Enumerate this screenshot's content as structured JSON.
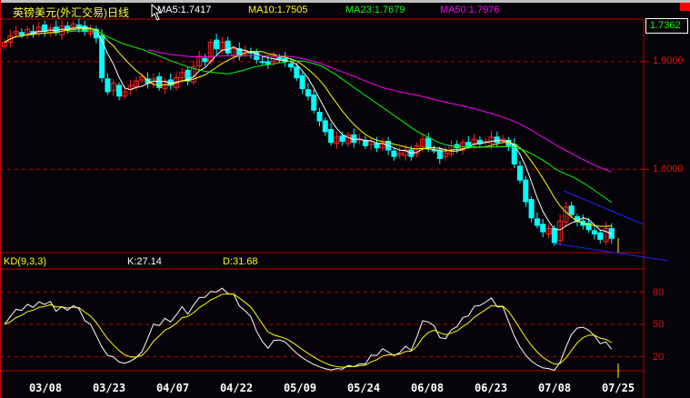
{
  "header": {
    "title": "英镑美元(外汇交易)日线",
    "ma5": "MA5:1.7417",
    "ma10": "MA10:1.7505",
    "ma23": "MA23:1.7679",
    "ma50": "MA50:1.7976",
    "current_price": "1.7362"
  },
  "kd": {
    "label": "KD(9,3,3)",
    "k": "K:27.14",
    "d": "D:31.68"
  },
  "colors": {
    "up": "#ff2020",
    "down": "#00ffff",
    "ma5": "#ffffff",
    "ma10": "#ffff00",
    "ma23": "#00ff00",
    "ma50": "#ff00ff",
    "trend": "#2020ff",
    "grid": "#c00000"
  },
  "chart_data": {
    "type": "candlestick",
    "title": "英镑美元(外汇交易)日线",
    "y_ticks": [
      "1.9000",
      "1.8000"
    ],
    "ylim": [
      1.7227,
      1.9395
    ],
    "kd_ticks": [
      "80",
      "50",
      "20"
    ],
    "x_ticks": [
      "03/08",
      "03/23",
      "04/07",
      "04/22",
      "05/09",
      "05/24",
      "06/08",
      "06/23",
      "07/08",
      "07/25"
    ],
    "closes": [
      1.918,
      1.924,
      1.928,
      1.925,
      1.93,
      1.926,
      1.932,
      1.928,
      1.931,
      1.927,
      1.933,
      1.93,
      1.935,
      1.932,
      1.928,
      1.93,
      1.922,
      1.885,
      1.872,
      1.88,
      1.868,
      1.872,
      1.878,
      1.882,
      1.886,
      1.88,
      1.884,
      1.876,
      1.882,
      1.878,
      1.885,
      1.89,
      1.882,
      1.895,
      1.905,
      1.9,
      1.918,
      1.912,
      1.918,
      1.908,
      1.912,
      1.905,
      1.91,
      1.908,
      1.902,
      1.9,
      1.898,
      1.905,
      1.902,
      1.9,
      1.895,
      1.885,
      1.875,
      1.868,
      1.855,
      1.845,
      1.835,
      1.825,
      1.83,
      1.826,
      1.832,
      1.825,
      1.828,
      1.822,
      1.826,
      1.82,
      1.824,
      1.818,
      1.812,
      1.815,
      1.818,
      1.812,
      1.822,
      1.828,
      1.82,
      1.818,
      1.81,
      1.815,
      1.822,
      1.82,
      1.825,
      1.822,
      1.828,
      1.824,
      1.826,
      1.83,
      1.825,
      1.828,
      1.822,
      1.805,
      1.79,
      1.77,
      1.755,
      1.748,
      1.742,
      1.745,
      1.732,
      1.752,
      1.765,
      1.758,
      1.752,
      1.748,
      1.744,
      1.74,
      1.735,
      1.745,
      1.736
    ]
  }
}
